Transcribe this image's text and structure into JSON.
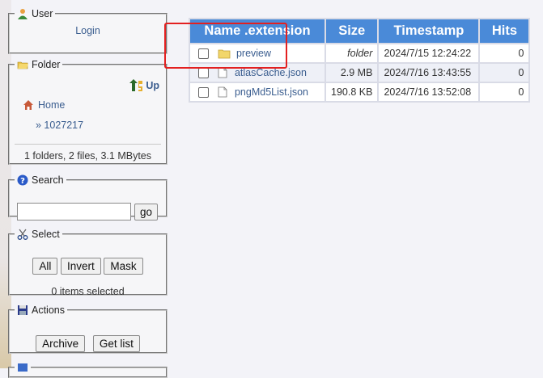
{
  "user": {
    "legend": "User",
    "login": "Login"
  },
  "folder": {
    "legend": "Folder",
    "up_label": "Up",
    "home": "Home",
    "crumb": "» 1027217",
    "summary": "1 folders, 2 files, 3.1 MBytes"
  },
  "search": {
    "legend": "Search",
    "value": "",
    "go": "go"
  },
  "select": {
    "legend": "Select",
    "all": "All",
    "invert": "Invert",
    "mask": "Mask",
    "status": "0 items selected"
  },
  "actions": {
    "legend": "Actions",
    "archive": "Archive",
    "getlist": "Get list"
  },
  "table": {
    "headers": {
      "name": "Name .extension",
      "size": "Size",
      "timestamp": "Timestamp",
      "hits": "Hits"
    },
    "rows": [
      {
        "name": "preview",
        "size": "folder",
        "timestamp": "2024/7/15 12:24:22",
        "hits": "0",
        "type": "folder"
      },
      {
        "name": "atlasCache.json",
        "size": "2.9 MB",
        "timestamp": "2024/7/16 13:43:55",
        "hits": "0",
        "type": "file"
      },
      {
        "name": "pngMd5List.json",
        "size": "190.8 KB",
        "timestamp": "2024/7/16 13:52:08",
        "hits": "0",
        "type": "file"
      }
    ]
  },
  "colors": {
    "header_bg": "#4a8ad8",
    "highlight": "#e32020",
    "link": "#3a5d8f"
  }
}
